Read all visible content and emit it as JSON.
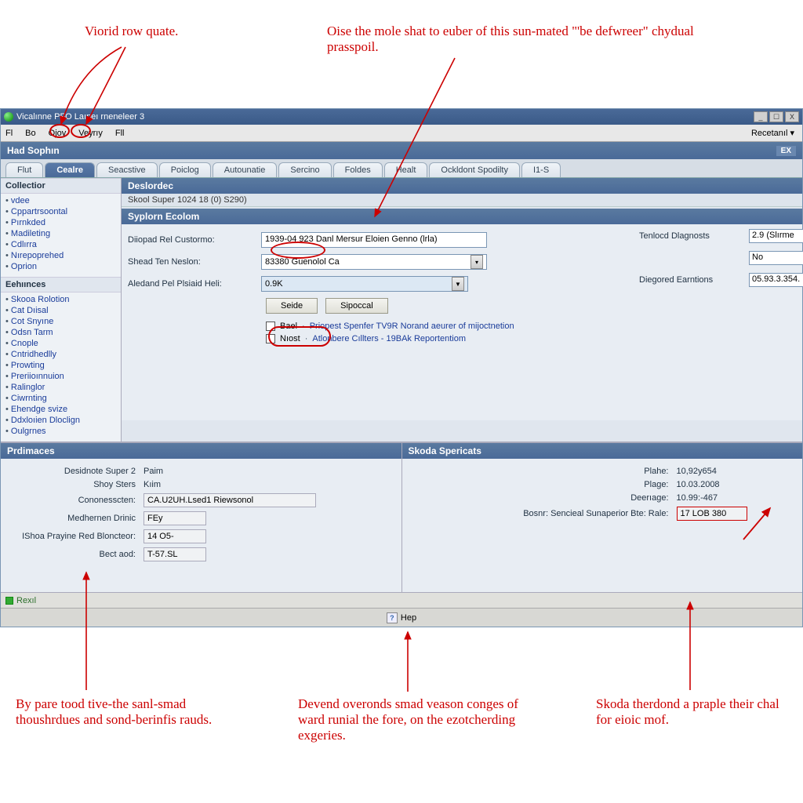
{
  "annotations": {
    "top_left": "Viorid row quate.",
    "top_right": "Oise the mole shat to euber of this sun-mated \"'be defwreer\" chydual prasspoil.",
    "bottom_left": "By pare tood tive-the sanl-smad thoushrdues and sond-berinfis rauds.",
    "bottom_mid": "Devend overonds smad veason conges of ward runial the fore, on the ezotcherding exgeries.",
    "bottom_right": "Skoda therdond a praple their chal for eioic mof."
  },
  "window": {
    "title": "Vicalınne PFO Laıpeı rneneleer 3",
    "controls": {
      "min": "_",
      "max": "☐",
      "close": "X"
    }
  },
  "menubar": {
    "items": [
      "Fl",
      "Bo",
      "Ojoy",
      "Veyrıy",
      "Fll"
    ],
    "right": "Recetanıl ▾"
  },
  "app_header": {
    "title": "Had Sophın",
    "ex": "EX"
  },
  "tabs": [
    "Flut",
    "Cealre",
    "Seacstive",
    "Poiclog",
    "Autounatie",
    "Sercino",
    "Foldes",
    "Healt",
    "Ockldont Spodilty",
    "I1-S"
  ],
  "active_tab_index": 1,
  "sidebar": {
    "sections": [
      {
        "title": "Collectior",
        "items": [
          "vdee",
          "Cppartrsoontal",
          "Pırnkded",
          "Madileting",
          "Cdlırra",
          "Nırepoprehed",
          "Oprion"
        ]
      },
      {
        "title": "Eehıınces",
        "items": [
          "Skooa Rolotion",
          "Cat Dıisal",
          "Cot Snyıne",
          "Odsn Tarm",
          "Cnople",
          "Cntridhedlly",
          "Prowting",
          "Preriioınnuion",
          "Ralinglor",
          "Ciwrnting",
          "Ehendge svize",
          "Ddxloıien Dloclign",
          "Oulgrnes"
        ]
      }
    ]
  },
  "main": {
    "panel_title": "Deslordec",
    "sub_line": "Skool Super 1024 18 (0) S290)",
    "section_title": "Syplorn Ecolom",
    "fields": {
      "f1_label": "Diiopad Rel Custormo:",
      "f1_value": "1939-04 923 Danl Mersur Eloien Genno (lrla)",
      "f2_label": "Shead Ten Neslon:",
      "f2_value": "83380 Guenolol Ca",
      "f3_label": "Aledand Pel Plsiaid Heli:",
      "f3_value": "0.9K"
    },
    "right": {
      "r1_label": "Tenlocd Dlagnosts",
      "r1_value": "2.9  (Slırme",
      "r2_value": "No",
      "r3_label": "Diegored Earntions",
      "r3_value": "05.93.3.354."
    },
    "buttons": {
      "primary": "Seide",
      "secondary": "Sipoccal"
    },
    "checks": {
      "c1_label": "Bael",
      "c1_link": "Priopest Spenfer TV9R Norand aeurer of mijoctnetion",
      "c2_label": "Nıost",
      "c2_link": "Atlonbere Cıllters - 19BAk Reportentiom"
    }
  },
  "bottom": {
    "left_title": "Prdimaces",
    "left_rows": [
      {
        "label": "Desidnote Super 2",
        "value": "Paim"
      },
      {
        "label": "Shoy Sters",
        "value": "Kıim"
      },
      {
        "label": "Cononesscten:",
        "value": "CA.U2UH.Lsed1 Riewsonol"
      },
      {
        "label": "Medhernen Drinic",
        "value": "FEy"
      },
      {
        "label": "IShoa Prayine Red Bloncteor:",
        "value": "14 O5-"
      },
      {
        "label": "Bect aod:",
        "value": "T-57.SL"
      }
    ],
    "right_title": "Skoda Spericats",
    "right_rows": [
      {
        "label": "Plahe:",
        "value": "10,92y654"
      },
      {
        "label": "Plage:",
        "value": "10.03.2008"
      },
      {
        "label": "Deerıage:",
        "value": "10.99:-467"
      },
      {
        "label": "Bosnr: Sencieal Sunaperior Bte: Rale:",
        "value": "17 LOB 380"
      }
    ]
  },
  "statusbar": {
    "text": "Rexıl"
  },
  "footer": {
    "help": "Hep"
  }
}
